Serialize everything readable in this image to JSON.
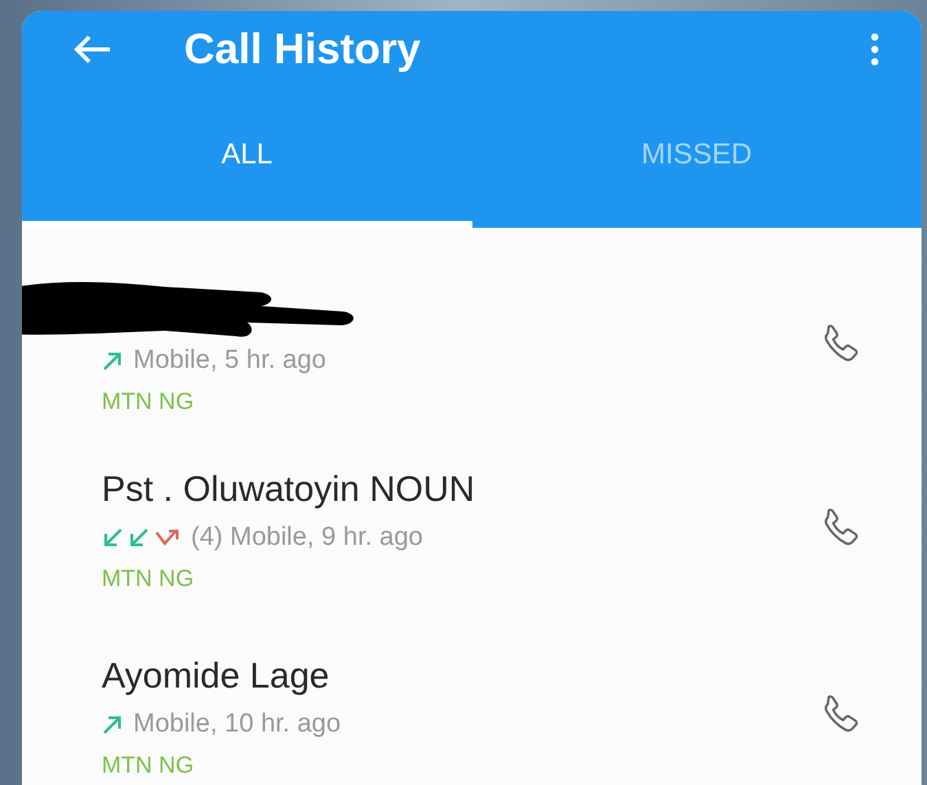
{
  "app_bar": {
    "title": "Call History"
  },
  "tabs": [
    {
      "label": "ALL",
      "selected": true
    },
    {
      "label": "MISSED",
      "selected": false
    }
  ],
  "calls": [
    {
      "name_redacted": true,
      "directions": [
        {
          "kind": "outgoing"
        }
      ],
      "detail": "Mobile, 5 hr. ago",
      "network": "MTN NG"
    },
    {
      "name": "Pst . Oluwatoyin NOUN",
      "directions": [
        {
          "kind": "incoming"
        },
        {
          "kind": "incoming"
        },
        {
          "kind": "rejected"
        }
      ],
      "detail": "(4) Mobile, 9 hr. ago",
      "network": "MTN NG"
    },
    {
      "name": "Ayomide Lage",
      "directions": [
        {
          "kind": "outgoing"
        }
      ],
      "detail": "Mobile, 10 hr. ago",
      "network": "MTN NG"
    }
  ]
}
